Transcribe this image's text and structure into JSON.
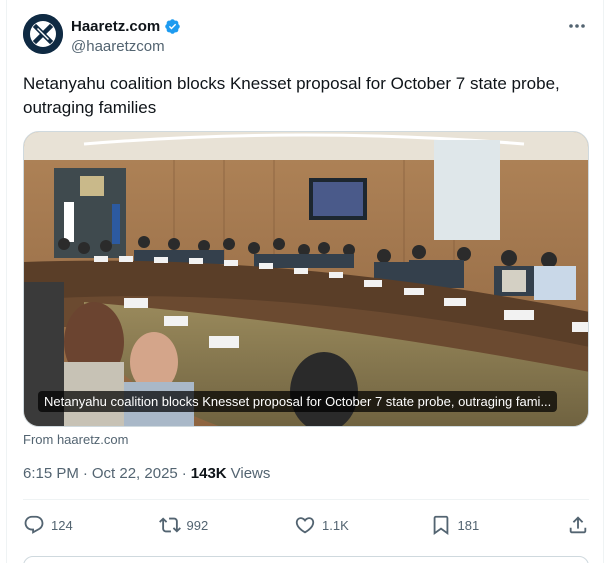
{
  "author": {
    "display_name": "Haaretz.com",
    "handle": "@haaretzcom",
    "verified": true,
    "avatar_icon": "haaretz-logo-icon"
  },
  "tweet": {
    "text": "Netanyahu coalition blocks Knesset proposal for October 7 state probe, outraging families"
  },
  "media": {
    "caption": "Netanyahu coalition blocks Knesset proposal for October 7 state probe, outraging fami..."
  },
  "source": "From haaretz.com",
  "meta": {
    "time": "6:15 PM",
    "date": "Oct 22, 2025",
    "separator": "·",
    "views_count": "143K",
    "views_label": "Views"
  },
  "actions": {
    "replies": "124",
    "reposts": "992",
    "likes": "1.1K",
    "bookmarks": "181"
  },
  "colors": {
    "text_primary": "#0f1419",
    "text_secondary": "#536471",
    "verified_blue": "#1d9bf0",
    "border": "#cfd9de"
  }
}
